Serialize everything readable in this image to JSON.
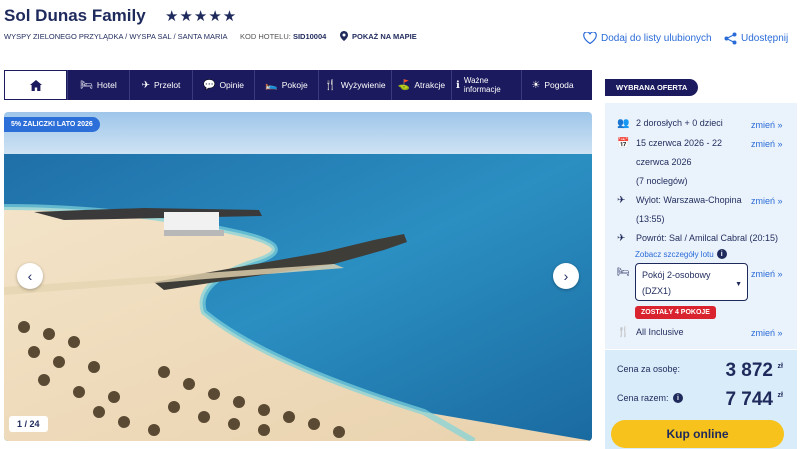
{
  "header": {
    "title": "Sol Dunas Family",
    "stars": "★★★★★",
    "breadcrumb": "WYSPY ZIELONEGO PRZYLĄDKA / WYSPA SAL / SANTA MARIA",
    "hotel_code_label": "KOD HOTELU:",
    "hotel_code": "SID10004",
    "map_link": "POKAŻ NA MAPIE",
    "favorite": "Dodaj do listy ulubionych",
    "share": "Udostępnij"
  },
  "nav": {
    "home_icon": "home-icon",
    "items": [
      {
        "icon": "hotel-icon",
        "glyph": "🛏",
        "label": "Hotel"
      },
      {
        "icon": "plane-icon",
        "glyph": "✈",
        "label": "Przelot"
      },
      {
        "icon": "comment-icon",
        "glyph": "💬",
        "label": "Opinie"
      },
      {
        "icon": "bed-icon",
        "glyph": "🛌",
        "label": "Pokoje"
      },
      {
        "icon": "fork-knife-icon",
        "glyph": "🍴",
        "label": "Wyżywienie"
      },
      {
        "icon": "signpost-icon",
        "glyph": "⛳",
        "label": "Atrakcje"
      },
      {
        "icon": "info-icon",
        "glyph": "ℹ",
        "label": "Ważne informacje"
      },
      {
        "icon": "sun-icon",
        "glyph": "☀",
        "label": "Pogoda"
      }
    ]
  },
  "gallery": {
    "promo_badge": "5% ZALICZKI LATO 2026",
    "counter": "1 / 24"
  },
  "offer": {
    "tab_label": "WYBRANA OFERTA",
    "change_label": "zmień »",
    "guests": "2 dorosłych + 0 dzieci",
    "dates_line1": "15 czerwca 2026 - 22",
    "dates_line2": "czerwca 2026",
    "nights": "(7 noclegów)",
    "departure_line1": "Wylot: Warszawa-Chopina",
    "departure_line2": "(13:55)",
    "return": "Powrót: Sal / Amilcal Cabral (20:15)",
    "flight_details": "Zobacz szczegóły lotu",
    "room_line1": "Pokój 2-osobowy",
    "room_line2": "(DZX1)",
    "rooms_left": "ZOSTAŁY 4 POKOJE",
    "board": "All Inclusive"
  },
  "price": {
    "per_person_label": "Cena za osobę:",
    "per_person": "3 872",
    "total_label": "Cena razem:",
    "total": "7 744",
    "currency": "zł",
    "buy": "Kup online"
  },
  "colors": {
    "navy": "#1c1a5e",
    "accent_blue": "#2a6bd8",
    "buy_yellow": "#f7c21b",
    "alert_red": "#d9232e"
  }
}
